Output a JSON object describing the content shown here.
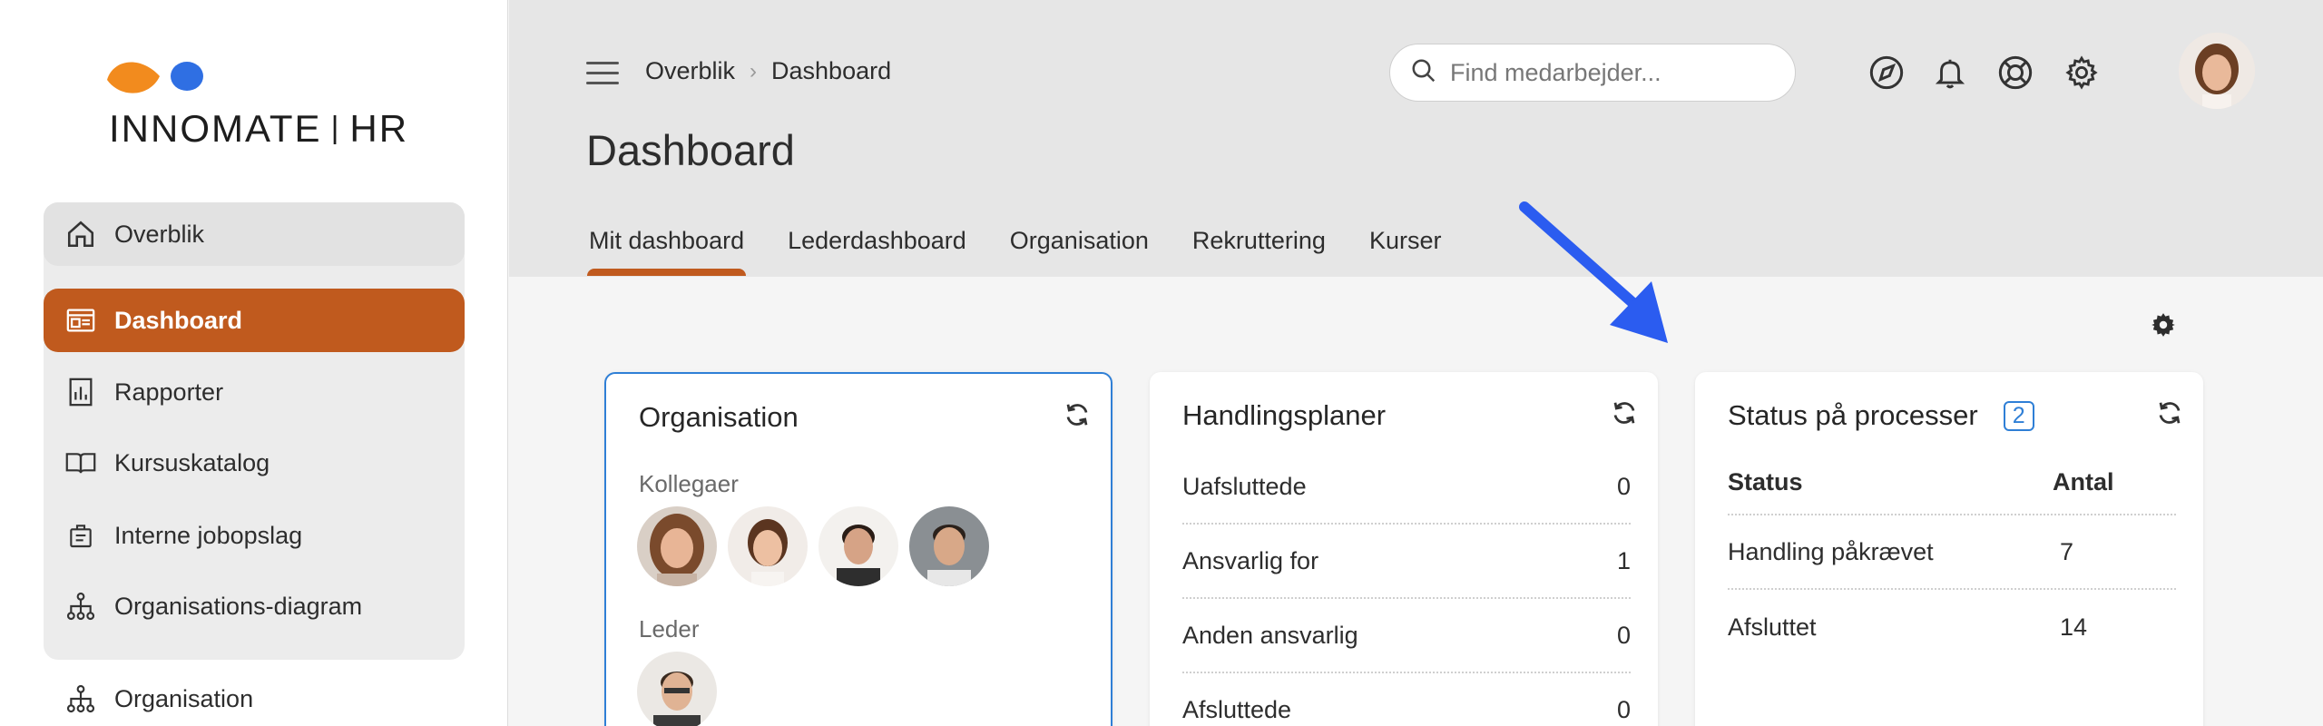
{
  "brand": {
    "name_part1": "INNOMATE",
    "name_part2": "HR",
    "separator": "|",
    "accent": "#c05a1e",
    "logo_orange": "#f28b1e",
    "logo_blue": "#2f6fe3"
  },
  "sidebar": {
    "items": [
      {
        "label": "Overblik",
        "icon": "home-icon"
      },
      {
        "label": "Dashboard",
        "icon": "dashboard-icon"
      },
      {
        "label": "Rapporter",
        "icon": "report-icon"
      },
      {
        "label": "Kursuskatalog",
        "icon": "book-icon"
      },
      {
        "label": "Interne jobopslag",
        "icon": "job-icon"
      },
      {
        "label": "Organisations-diagram",
        "icon": "org-chart-icon"
      },
      {
        "label": "Organisation",
        "icon": "org-chart-icon"
      }
    ]
  },
  "header": {
    "breadcrumb": [
      "Overblik",
      "Dashboard"
    ],
    "title": "Dashboard",
    "search_placeholder": "Find medarbejder...",
    "tabs": [
      "Mit dashboard",
      "Lederdashboard",
      "Organisation",
      "Rekruttering",
      "Kurser"
    ],
    "icons": [
      "navigate-icon",
      "bell-icon",
      "help-lifebuoy-icon",
      "settings-gear-icon"
    ]
  },
  "cards": {
    "organisation": {
      "title": "Organisation",
      "colleagues_label": "Kollegaer",
      "leader_label": "Leder"
    },
    "plans": {
      "title": "Handlingsplaner",
      "rows": [
        {
          "label": "Uafsluttede",
          "value": "0"
        },
        {
          "label": "Ansvarlig for",
          "value": "1"
        },
        {
          "label": "Anden ansvarlig",
          "value": "0"
        },
        {
          "label": "Afsluttede",
          "value": "0"
        }
      ]
    },
    "status": {
      "title": "Status på processer",
      "badge": "2",
      "col_status": "Status",
      "col_count": "Antal",
      "rows": [
        {
          "label": "Handling påkrævet",
          "value": "7"
        },
        {
          "label": "Afsluttet",
          "value": "14"
        }
      ]
    }
  }
}
